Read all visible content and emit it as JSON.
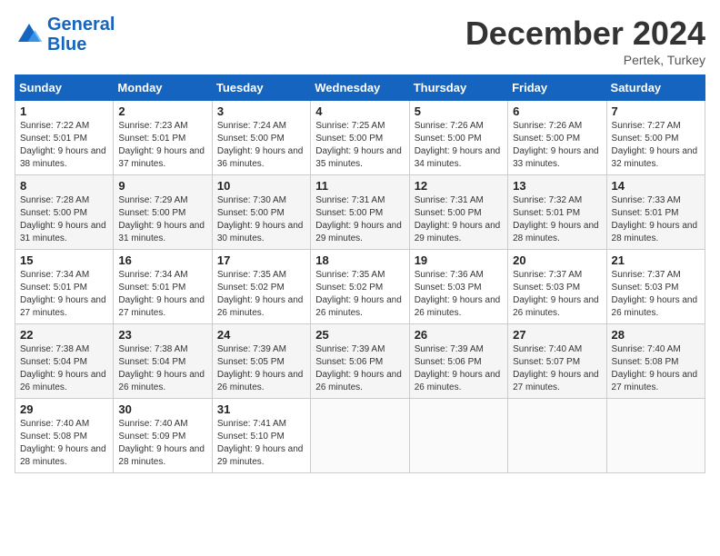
{
  "logo": {
    "line1": "General",
    "line2": "Blue"
  },
  "title": "December 2024",
  "subtitle": "Pertek, Turkey",
  "days_of_week": [
    "Sunday",
    "Monday",
    "Tuesday",
    "Wednesday",
    "Thursday",
    "Friday",
    "Saturday"
  ],
  "weeks": [
    [
      {
        "day": 1,
        "sunrise": "7:22 AM",
        "sunset": "5:01 PM",
        "daylight": "9 hours and 38 minutes."
      },
      {
        "day": 2,
        "sunrise": "7:23 AM",
        "sunset": "5:01 PM",
        "daylight": "9 hours and 37 minutes."
      },
      {
        "day": 3,
        "sunrise": "7:24 AM",
        "sunset": "5:00 PM",
        "daylight": "9 hours and 36 minutes."
      },
      {
        "day": 4,
        "sunrise": "7:25 AM",
        "sunset": "5:00 PM",
        "daylight": "9 hours and 35 minutes."
      },
      {
        "day": 5,
        "sunrise": "7:26 AM",
        "sunset": "5:00 PM",
        "daylight": "9 hours and 34 minutes."
      },
      {
        "day": 6,
        "sunrise": "7:26 AM",
        "sunset": "5:00 PM",
        "daylight": "9 hours and 33 minutes."
      },
      {
        "day": 7,
        "sunrise": "7:27 AM",
        "sunset": "5:00 PM",
        "daylight": "9 hours and 32 minutes."
      }
    ],
    [
      {
        "day": 8,
        "sunrise": "7:28 AM",
        "sunset": "5:00 PM",
        "daylight": "9 hours and 31 minutes."
      },
      {
        "day": 9,
        "sunrise": "7:29 AM",
        "sunset": "5:00 PM",
        "daylight": "9 hours and 31 minutes."
      },
      {
        "day": 10,
        "sunrise": "7:30 AM",
        "sunset": "5:00 PM",
        "daylight": "9 hours and 30 minutes."
      },
      {
        "day": 11,
        "sunrise": "7:31 AM",
        "sunset": "5:00 PM",
        "daylight": "9 hours and 29 minutes."
      },
      {
        "day": 12,
        "sunrise": "7:31 AM",
        "sunset": "5:00 PM",
        "daylight": "9 hours and 29 minutes."
      },
      {
        "day": 13,
        "sunrise": "7:32 AM",
        "sunset": "5:01 PM",
        "daylight": "9 hours and 28 minutes."
      },
      {
        "day": 14,
        "sunrise": "7:33 AM",
        "sunset": "5:01 PM",
        "daylight": "9 hours and 28 minutes."
      }
    ],
    [
      {
        "day": 15,
        "sunrise": "7:34 AM",
        "sunset": "5:01 PM",
        "daylight": "9 hours and 27 minutes."
      },
      {
        "day": 16,
        "sunrise": "7:34 AM",
        "sunset": "5:01 PM",
        "daylight": "9 hours and 27 minutes."
      },
      {
        "day": 17,
        "sunrise": "7:35 AM",
        "sunset": "5:02 PM",
        "daylight": "9 hours and 26 minutes."
      },
      {
        "day": 18,
        "sunrise": "7:35 AM",
        "sunset": "5:02 PM",
        "daylight": "9 hours and 26 minutes."
      },
      {
        "day": 19,
        "sunrise": "7:36 AM",
        "sunset": "5:03 PM",
        "daylight": "9 hours and 26 minutes."
      },
      {
        "day": 20,
        "sunrise": "7:37 AM",
        "sunset": "5:03 PM",
        "daylight": "9 hours and 26 minutes."
      },
      {
        "day": 21,
        "sunrise": "7:37 AM",
        "sunset": "5:03 PM",
        "daylight": "9 hours and 26 minutes."
      }
    ],
    [
      {
        "day": 22,
        "sunrise": "7:38 AM",
        "sunset": "5:04 PM",
        "daylight": "9 hours and 26 minutes."
      },
      {
        "day": 23,
        "sunrise": "7:38 AM",
        "sunset": "5:04 PM",
        "daylight": "9 hours and 26 minutes."
      },
      {
        "day": 24,
        "sunrise": "7:39 AM",
        "sunset": "5:05 PM",
        "daylight": "9 hours and 26 minutes."
      },
      {
        "day": 25,
        "sunrise": "7:39 AM",
        "sunset": "5:06 PM",
        "daylight": "9 hours and 26 minutes."
      },
      {
        "day": 26,
        "sunrise": "7:39 AM",
        "sunset": "5:06 PM",
        "daylight": "9 hours and 26 minutes."
      },
      {
        "day": 27,
        "sunrise": "7:40 AM",
        "sunset": "5:07 PM",
        "daylight": "9 hours and 27 minutes."
      },
      {
        "day": 28,
        "sunrise": "7:40 AM",
        "sunset": "5:08 PM",
        "daylight": "9 hours and 27 minutes."
      }
    ],
    [
      {
        "day": 29,
        "sunrise": "7:40 AM",
        "sunset": "5:08 PM",
        "daylight": "9 hours and 28 minutes."
      },
      {
        "day": 30,
        "sunrise": "7:40 AM",
        "sunset": "5:09 PM",
        "daylight": "9 hours and 28 minutes."
      },
      {
        "day": 31,
        "sunrise": "7:41 AM",
        "sunset": "5:10 PM",
        "daylight": "9 hours and 29 minutes."
      },
      null,
      null,
      null,
      null
    ]
  ]
}
